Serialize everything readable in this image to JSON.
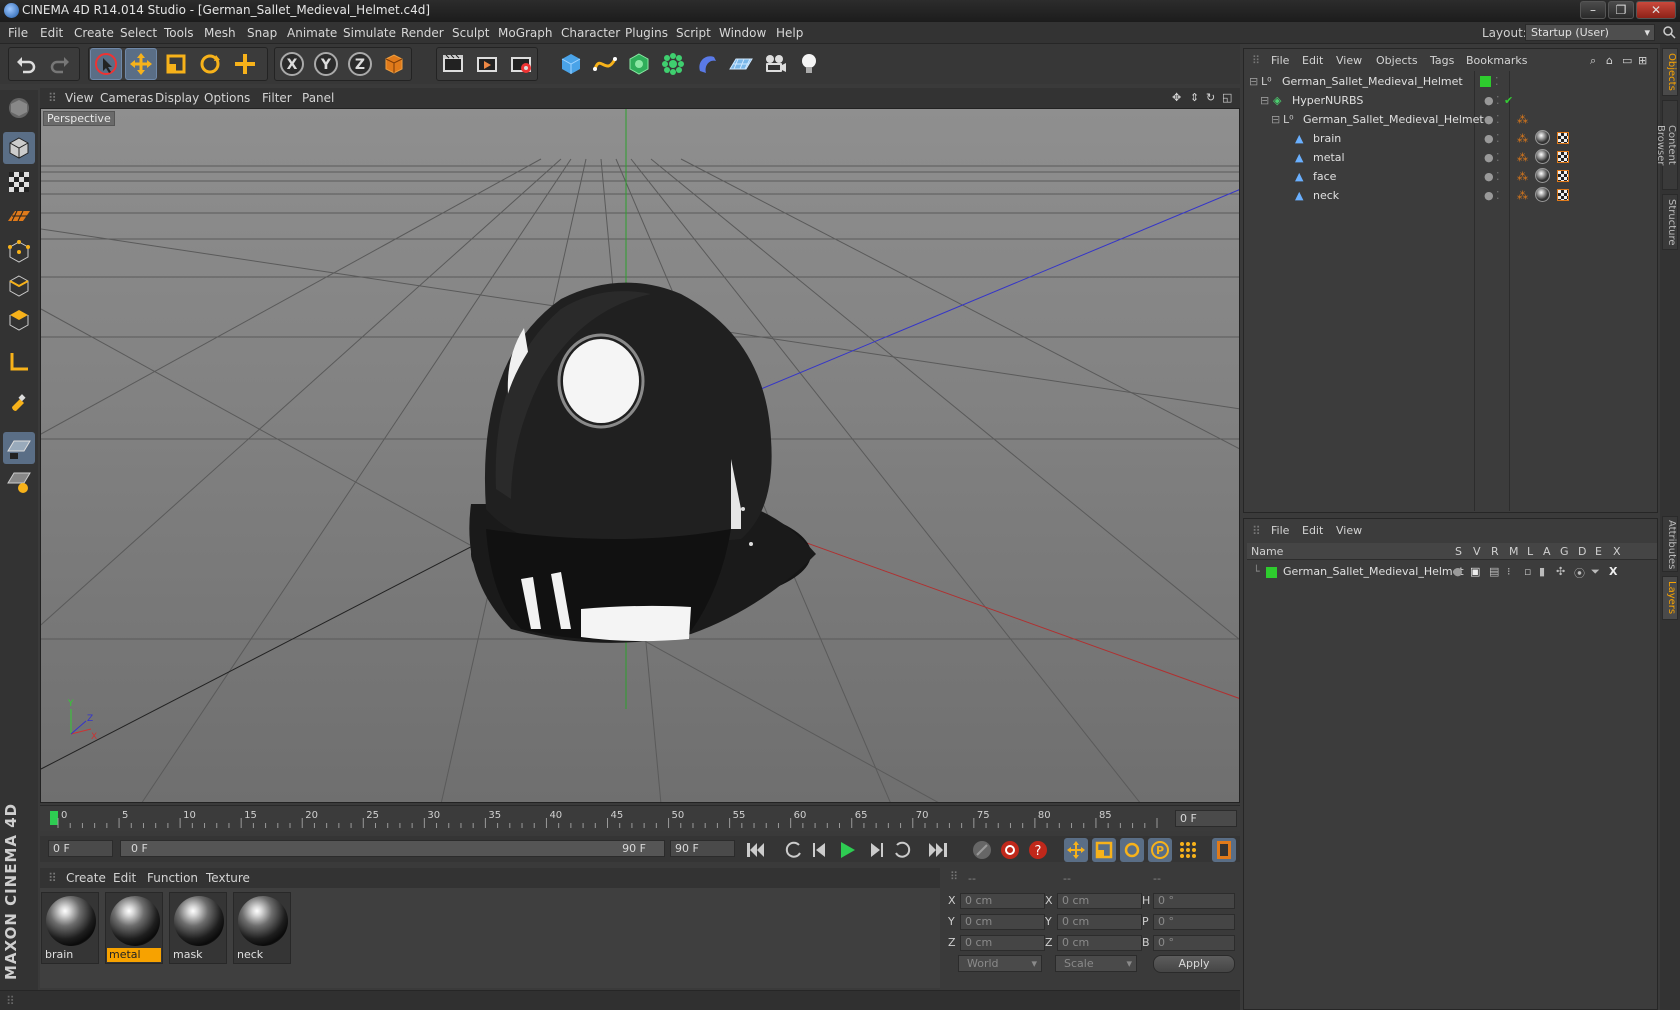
{
  "window": {
    "title": "CINEMA 4D R14.014 Studio - [German_Sallet_Medieval_Helmet.c4d]",
    "minimize": "–",
    "restore": "❐",
    "close": "✕"
  },
  "menu": {
    "items": [
      "File",
      "Edit",
      "Create",
      "Select",
      "Tools",
      "Mesh",
      "Snap",
      "Animate",
      "Simulate",
      "Render",
      "Sculpt",
      "MoGraph",
      "Character",
      "Plugins",
      "Script",
      "Window",
      "Help"
    ],
    "layout_label": "Layout:",
    "layout_value": "Startup (User)"
  },
  "viewport": {
    "menu": [
      "View",
      "Cameras",
      "Display",
      "Options",
      "Filter",
      "Panel"
    ],
    "label": "Perspective"
  },
  "timeline": {
    "ticks": [
      "0",
      "5",
      "10",
      "15",
      "20",
      "25",
      "30",
      "35",
      "40",
      "45",
      "50",
      "55",
      "60",
      "65",
      "70",
      "75",
      "80",
      "85",
      "90"
    ],
    "current_frame": "0 F",
    "start_field": "0 F",
    "range_start": "0 F",
    "range_end": "90 F",
    "end_field": "90 F"
  },
  "materials": {
    "menu": [
      "Create",
      "Edit",
      "Function",
      "Texture"
    ],
    "items": [
      {
        "name": "brain",
        "selected": false
      },
      {
        "name": "metal",
        "selected": true
      },
      {
        "name": "mask",
        "selected": false
      },
      {
        "name": "neck",
        "selected": false
      }
    ]
  },
  "coordinates": {
    "col_headers": [
      "--",
      "--",
      "--"
    ],
    "rows": [
      {
        "a": "X",
        "av": "0 cm",
        "b": "X",
        "bv": "0 cm",
        "c": "H",
        "cv": "0 °"
      },
      {
        "a": "Y",
        "av": "0 cm",
        "b": "Y",
        "bv": "0 cm",
        "c": "P",
        "cv": "0 °"
      },
      {
        "a": "Z",
        "av": "0 cm",
        "b": "Z",
        "bv": "0 cm",
        "c": "B",
        "cv": "0 °"
      }
    ],
    "mode": "World",
    "mode2": "Scale",
    "apply": "Apply"
  },
  "objects": {
    "menu": [
      "File",
      "Edit",
      "View",
      "Objects",
      "Tags",
      "Bookmarks"
    ],
    "rows": [
      {
        "name": "German_Sallet_Medieval_Helmet",
        "indent": 0
      },
      {
        "name": "HyperNURBS",
        "indent": 1
      },
      {
        "name": "German_Sallet_Medieval_Helmet",
        "indent": 2
      },
      {
        "name": "brain",
        "indent": 3
      },
      {
        "name": "metal",
        "indent": 3
      },
      {
        "name": "face",
        "indent": 3
      },
      {
        "name": "neck",
        "indent": 3
      }
    ]
  },
  "layers": {
    "menu": [
      "File",
      "Edit",
      "View"
    ],
    "columns": [
      "Name",
      "S",
      "V",
      "R",
      "M",
      "L",
      "A",
      "G",
      "D",
      "E",
      "X"
    ],
    "row": "German_Sallet_Medieval_Helmet"
  },
  "side_tabs": [
    "Objects",
    "Content Browser",
    "Structure",
    "Attributes",
    "Layers"
  ],
  "brand": "MAXON CINEMA 4D",
  "colors": {
    "accent": "#f7a200",
    "selection": "#5a6e86",
    "layer_green": "#33cc33"
  }
}
